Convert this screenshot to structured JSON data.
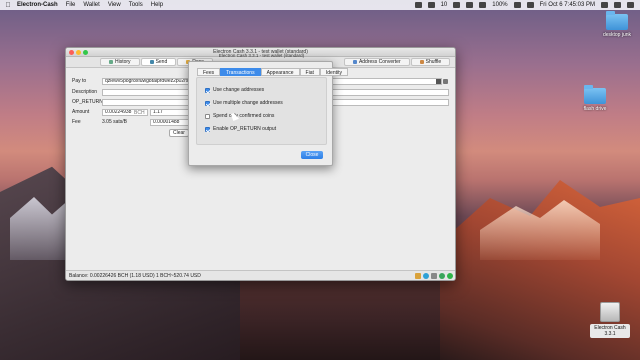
{
  "menubar": {
    "app_name": "Electron-Cash",
    "items": [
      "File",
      "Wallet",
      "View",
      "Tools",
      "Help"
    ],
    "battery": "100%",
    "clock": "Fri Oct 6  7:45:03 PM",
    "badge": "10"
  },
  "desktop": {
    "icons": [
      {
        "label": "desktop junk"
      },
      {
        "label": "flash drive"
      },
      {
        "label": "Electron Cash 3.3.1"
      }
    ]
  },
  "window": {
    "title": "Electron Cash 3.3.1  -  test wallet  (standard)",
    "tabs": [
      "History",
      "Send",
      "Rece",
      "Address Converter",
      "Shuffle"
    ],
    "form": {
      "pay_to_label": "Pay to",
      "pay_to_value": "qzlewv5p8gr8xfuwg8talprdwez2p02rsq0k",
      "description_label": "Description",
      "op_return_label": "OP_RETURN",
      "amount_label": "Amount",
      "amount_value": "0.00224938",
      "amount_unit": "BCH",
      "fiat_value": "1.17",
      "fee_label": "Fee",
      "fee_rate": "3.05 sats/B",
      "fee_value": "0.00001488",
      "clear_button": "Clear"
    },
    "status_bar": "Balance: 0.00226426 BCH (1.18 USD)  1 BCH~520.74 USD"
  },
  "dialog": {
    "subtitle": "Electron Cash 3.3.1  -  test wallet  (standard)",
    "tabs": [
      "Fees",
      "Transactions",
      "Appearance",
      "Fiat",
      "Identity"
    ],
    "active_tab": "Transactions",
    "options": [
      {
        "label": "Use change addresses",
        "checked": true
      },
      {
        "label": "Use multiple change addresses",
        "checked": true
      },
      {
        "label": "Spend only confirmed coins",
        "checked": false
      },
      {
        "label": "Enable OP_RETURN output",
        "checked": true
      }
    ],
    "close_button": "Close"
  },
  "colors": {
    "accent": "#3d8bea",
    "traffic_red": "#fc5f57",
    "traffic_yellow": "#fdbc2e",
    "traffic_green": "#34c84a"
  }
}
